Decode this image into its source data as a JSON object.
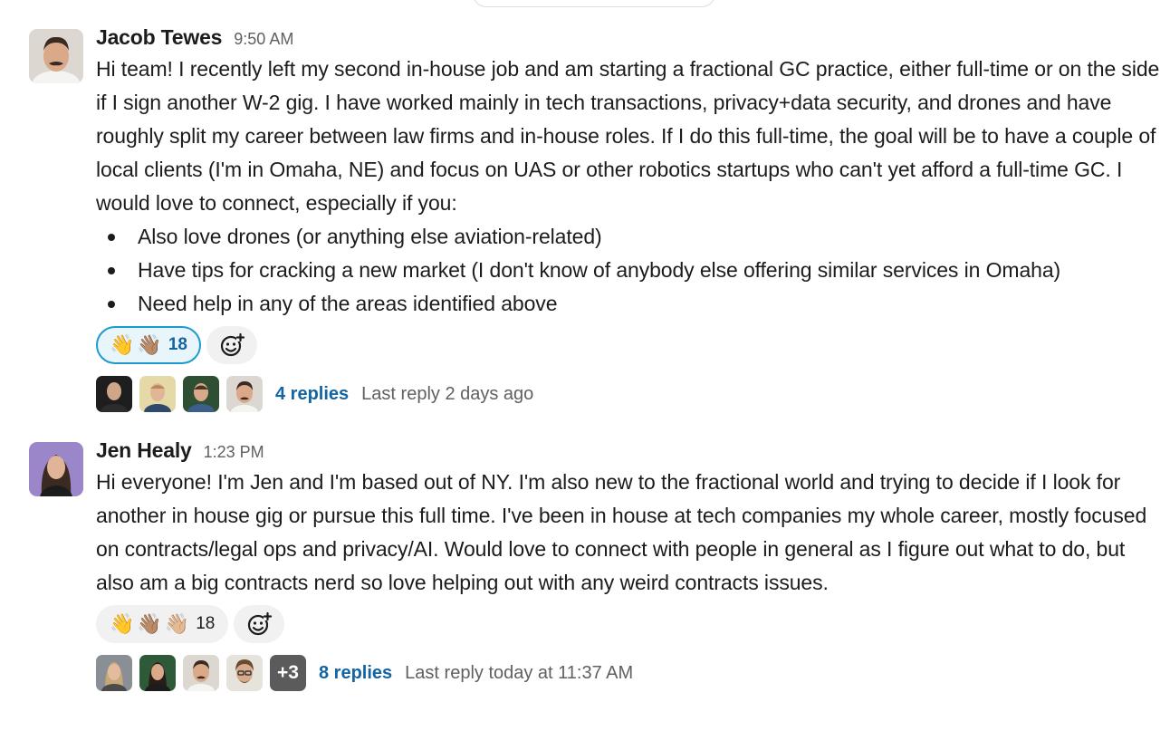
{
  "messages": [
    {
      "author": "Jacob Tewes",
      "time": "9:50 AM",
      "avatar_icon": "user-photo-avatar",
      "paragraph": "Hi team! I recently left my second in-house job and am starting a fractional GC practice, either full-time or on the side if I sign another W-2 gig. I have worked mainly in tech transactions, privacy+data security, and drones and have roughly split my career between law firms and in-house roles. If I do this full-time, the goal will be to have a couple of local clients (I'm in Omaha, NE) and focus on UAS or other robotics startups who can't yet afford a full-time GC. I would love to connect, especially if you:",
      "bullets": [
        "Also love drones (or anything else aviation-related)",
        "Have tips for cracking a new market (I don't know of anybody else offering similar services in Omaha)",
        "Need help in any of the areas identified above"
      ],
      "reaction": {
        "emojis": [
          "👋",
          "👋🏽"
        ],
        "count": "18",
        "active": true
      },
      "thread": {
        "replies": "4 replies",
        "last_reply": "Last reply 2 days ago",
        "extra_count": ""
      }
    },
    {
      "author": "Jen Healy",
      "time": "1:23 PM",
      "avatar_icon": "user-photo-avatar",
      "paragraph": "Hi everyone! I'm Jen and I'm based out of NY.  I'm also new to the fractional world and trying to decide if I look for another in house gig or pursue this full time.  I've been in house at tech companies my whole career, mostly focused on contracts/legal ops and privacy/AI.  Would love to connect with people in general as I figure out what to do, but also am a big contracts nerd so love helping out with any weird contracts issues.",
      "reaction": {
        "emojis": [
          "👋",
          "👋🏽",
          "👋🏼"
        ],
        "count": "18",
        "active": false
      },
      "thread": {
        "replies": "8 replies",
        "last_reply": "Last reply today at 11:37 AM",
        "extra_count": "+3"
      }
    }
  ],
  "icons": {
    "add_reaction": "add-emoji-reaction-icon"
  },
  "colors": {
    "link": "#1264a3",
    "active_reaction_border": "#1d9bd1",
    "active_reaction_bg": "#e8f5fa",
    "muted": "#616061"
  }
}
